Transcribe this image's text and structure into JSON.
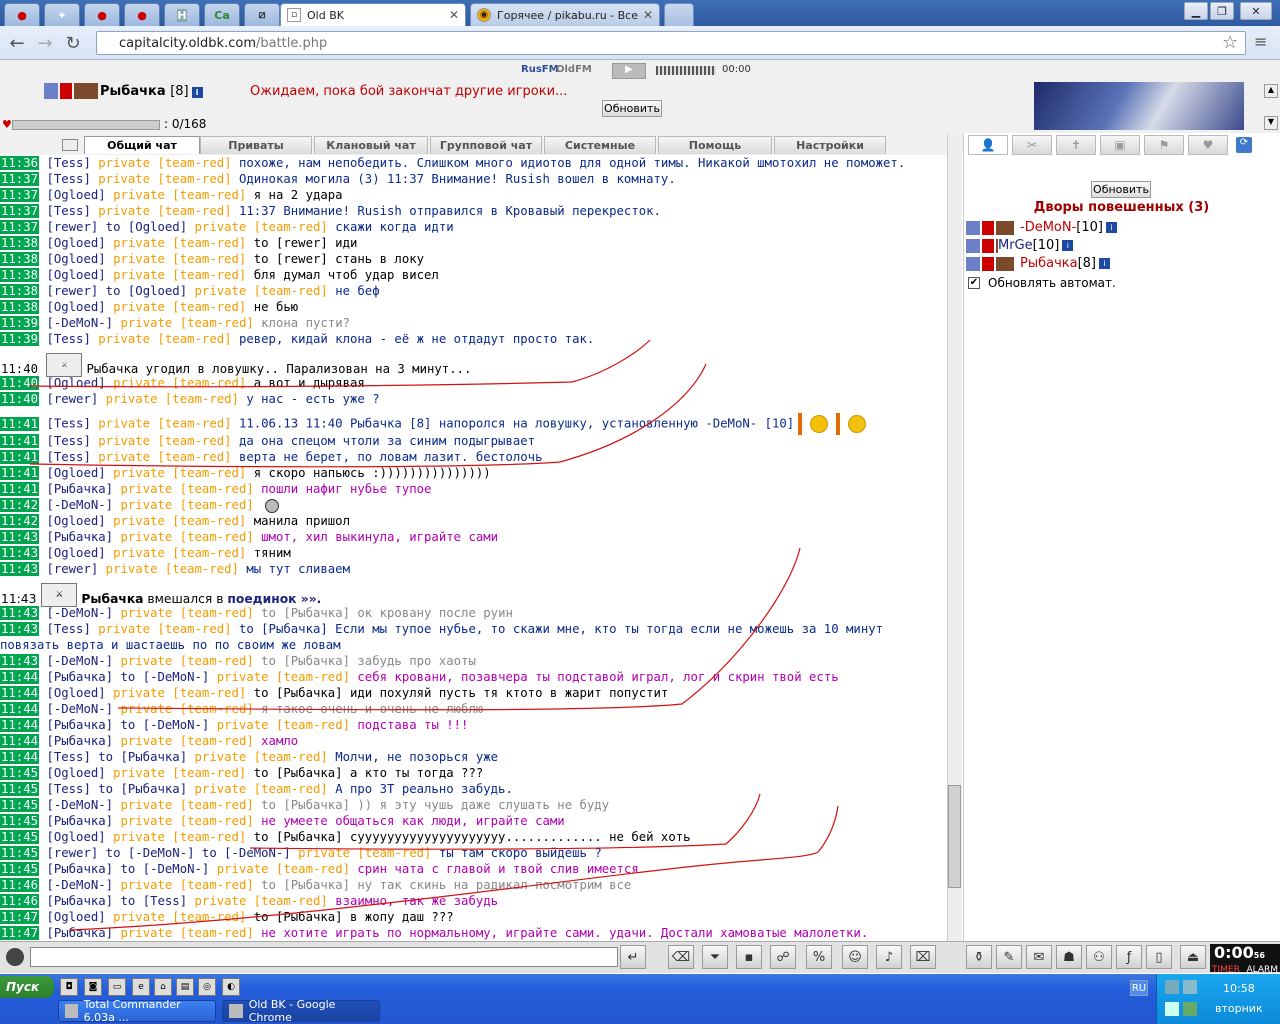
{
  "browser": {
    "pinned_tabs": [
      "",
      "",
      "",
      "",
      "H",
      "Ca",
      ""
    ],
    "tabs": [
      {
        "title": "Old BK",
        "active": true
      },
      {
        "title": "Горячее / pikabu.ru - Все",
        "active": false
      }
    ],
    "url_domain": "capitalcity.oldbk.com",
    "url_path": "/battle.php"
  },
  "header": {
    "radio_left": "RusFM",
    "radio_right": "OldFM",
    "radio_time": "00:00",
    "player_name": "Рыбачка",
    "player_level": "[8]",
    "wait_message": "Ожидаем, пока бой закончат другие игроки...",
    "refresh_label": "Обновить",
    "hp": ": 0/168"
  },
  "chat_tabs": [
    "Общий чат",
    "Приваты",
    "Клановый чат",
    "Групповой чат",
    "Системные",
    "Помощь",
    "Настройки"
  ],
  "chat_lines": [
    {
      "t": "11:36",
      "n": "[Tess]",
      "p": "private [team-red]",
      "m": "похоже, нам непобедить. Слишком много идиотов для одной тимы. Никакой шмотохил не поможет.",
      "c": "navy"
    },
    {
      "t": "11:37",
      "n": "[Tess]",
      "p": "private [team-red]",
      "m": "Одинокая могила (3) 11:37 Внимание! Rusish вошел в комнату.",
      "c": "navy"
    },
    {
      "t": "11:37",
      "n": "[Ogloed]",
      "p": "private [team-red]",
      "m": "я на 2 удара",
      "c": "black"
    },
    {
      "t": "11:37",
      "n": "[Tess]",
      "p": "private [team-red]",
      "m": "11:37 Внимание! Rusish отправился в Кровавый перекресток.",
      "c": "navy"
    },
    {
      "t": "11:37",
      "n": "[rewer]",
      "to": "to [Ogloed]",
      "p": "private [team-red]",
      "m": "скажи когда идти",
      "c": "navy"
    },
    {
      "t": "11:38",
      "n": "[Ogloed]",
      "p": "private [team-red]",
      "m": "to [rewer] иди",
      "c": "black"
    },
    {
      "t": "11:38",
      "n": "[Ogloed]",
      "p": "private [team-red]",
      "m": "to [rewer] стань в локу",
      "c": "black"
    },
    {
      "t": "11:38",
      "n": "[Ogloed]",
      "p": "private [team-red]",
      "m": "бля думал чтоб удар висел",
      "c": "black"
    },
    {
      "t": "11:38",
      "n": "[rewer]",
      "to": "to [Ogloed]",
      "p": "private [team-red]",
      "m": "не беф",
      "c": "navy"
    },
    {
      "t": "11:38",
      "n": "[Ogloed]",
      "p": "private [team-red]",
      "m": "не бью",
      "c": "black"
    },
    {
      "t": "11:39",
      "n": "[-DeMoN-]",
      "p": "private [team-red]",
      "m": "клона пусти?",
      "c": "gray"
    },
    {
      "t": "11:39",
      "n": "[Tess]",
      "p": "private [team-red]",
      "m": "ревер, кидай клона - её ж не отдадут просто так.",
      "c": "navy"
    },
    {
      "sys": true,
      "t": "11:40",
      "m": "Рыбачка угодил в ловушку.. Парализован на 3 минут..."
    },
    {
      "t": "11:40",
      "n": "[Ogloed]",
      "p": "private [team-red]",
      "m": "а вот и дырявая",
      "c": "black"
    },
    {
      "t": "11:40",
      "n": "[rewer]",
      "p": "private [team-red]",
      "m": "у нас - есть уже ?",
      "c": "navy"
    },
    {
      "trap": true,
      "t": "11:41",
      "n": "[Tess]",
      "p": "private [team-red]",
      "m": "11.06.13 11:40 Рыбачка [8] напоролся на ловушку, установленную -DeMoN- [10]",
      "c": "navy"
    },
    {
      "t": "11:41",
      "n": "[Tess]",
      "p": "private [team-red]",
      "m": "да она спецом чтоли за синим подыгрывает",
      "c": "navy"
    },
    {
      "t": "11:41",
      "n": "[Tess]",
      "p": "private [team-red]",
      "m": "верта не берет, по ловам лазит. бестолочь",
      "c": "navy"
    },
    {
      "t": "11:41",
      "n": "[Ogloed]",
      "p": "private [team-red]",
      "m": "я скоро напьюсь :)))))))))))))))",
      "c": "black"
    },
    {
      "t": "11:41",
      "n": "[Рыбачка]",
      "p": "private [team-red]",
      "m": "пошли нафиг нубье тупое",
      "c": "mag"
    },
    {
      "smile": true,
      "t": "11:42",
      "n": "[-DeMoN-]",
      "p": "private [team-red]",
      "m": "",
      "c": "gray"
    },
    {
      "t": "11:42",
      "n": "[Ogloed]",
      "p": "private [team-red]",
      "m": "манила пришол",
      "c": "black"
    },
    {
      "t": "11:43",
      "n": "[Рыбачка]",
      "p": "private [team-red]",
      "m": "шмот, хил выкинула, играйте сами",
      "c": "mag"
    },
    {
      "t": "11:43",
      "n": "[Ogloed]",
      "p": "private [team-red]",
      "m": "тяним",
      "c": "black"
    },
    {
      "t": "11:43",
      "n": "[rewer]",
      "p": "private [team-red]",
      "m": "мы тут сливаем",
      "c": "navy"
    },
    {
      "sys2": true,
      "t": "11:43",
      "m1": "Рыбачка",
      "m2": "вмешался в",
      "m3": "поединок »»."
    },
    {
      "t": "11:43",
      "n": "[-DeMoN-]",
      "p": "private [team-red]",
      "m": "to [Рыбачка] ок кровану после руин",
      "c": "gray"
    },
    {
      "wrap": true,
      "t": "11:43",
      "n": "[Tess]",
      "p": "private [team-red]",
      "m": "to [Рыбачка] Если мы тупое нубье, то скажи мне, кто ты тогда если не можешь за 10 минут повязать верта и шастаешь по по своим же ловам",
      "c": "navy"
    },
    {
      "t": "11:43",
      "n": "[-DeMoN-]",
      "p": "private [team-red]",
      "m": "to [Рыбачка] забудь про хаоты",
      "c": "gray"
    },
    {
      "t": "11:44",
      "n": "[Рыбачка]",
      "to": "to [-DeMoN-]",
      "p": "private [team-red]",
      "m": "себя кровани, позавчера ты подставой играл, лог и скрин твой есть",
      "c": "mag"
    },
    {
      "t": "11:44",
      "n": "[Ogloed]",
      "p": "private [team-red]",
      "m": "to [Рыбачка] иди похуляй пусть тя ктото в жарит попустит",
      "c": "black"
    },
    {
      "t": "11:44",
      "n": "[-DeMoN-]",
      "p": "private [team-red]",
      "m": "я такое очень и очень не люблю",
      "c": "gray"
    },
    {
      "t": "11:44",
      "n": "[Рыбачка]",
      "to": "to [-DeMoN-]",
      "p": "private [team-red]",
      "m": "подстава ты !!!",
      "c": "mag"
    },
    {
      "t": "11:44",
      "n": "[Рыбачка]",
      "p": "private [team-red]",
      "m": "хамло",
      "c": "mag"
    },
    {
      "t": "11:44",
      "n": "[Tess]",
      "to": "to [Рыбачка]",
      "p": "private [team-red]",
      "m": "Молчи, не позорься уже",
      "c": "navy"
    },
    {
      "t": "11:45",
      "n": "[Ogloed]",
      "p": "private [team-red]",
      "m": "to [Рыбачка] а кто ты тогда ???",
      "c": "black"
    },
    {
      "t": "11:45",
      "n": "[Tess]",
      "to": "to [Рыбачка]",
      "p": "private [team-red]",
      "m": "А про ЗТ реально забудь.",
      "c": "navy"
    },
    {
      "t": "11:45",
      "n": "[-DeMoN-]",
      "p": "private [team-red]",
      "m": "to [Рыбачка] )) я эту чушь даже слушать не буду",
      "c": "gray"
    },
    {
      "t": "11:45",
      "n": "[Рыбачка]",
      "p": "private [team-red]",
      "m": "не умеете общаться как люди, играйте сами",
      "c": "mag"
    },
    {
      "t": "11:45",
      "n": "[Ogloed]",
      "p": "private [team-red]",
      "m": "to [Рыбачка] суууууууууууууууууууу............. не бей хоть",
      "c": "black"
    },
    {
      "t": "11:45",
      "n": "[rewer]",
      "to": "to [-DeMoN-] to [-DeMoN-]",
      "p": "private [team-red]",
      "m": "ты там скоро выйдешь ?",
      "c": "navy"
    },
    {
      "t": "11:45",
      "n": "[Рыбачка]",
      "to": "to [-DeMoN-]",
      "p": "private [team-red]",
      "m": "срин чата с главой и твой слив имеется",
      "c": "mag"
    },
    {
      "t": "11:46",
      "n": "[-DeMoN-]",
      "p": "private [team-red]",
      "m": "to [Рыбачка] ну так скинь на радикал посмотрим все",
      "c": "gray"
    },
    {
      "t": "11:46",
      "n": "[Рыбачка]",
      "to": "to [Tess]",
      "p": "private [team-red]",
      "m": "взаимно, так же забудь",
      "c": "mag"
    },
    {
      "t": "11:47",
      "n": "[Ogloed]",
      "p": "private [team-red]",
      "m": "to [Рыбачка] в жопу даш ???",
      "c": "black"
    },
    {
      "t": "11:47",
      "n": "[Рыбачка]",
      "p": "private [team-red]",
      "m": "не хотите играть по нормальному, играйте сами. удачи. Достали хамоватые малолетки.",
      "c": "mag"
    }
  ],
  "right_panel": {
    "refresh_label": "Обновить",
    "title": "Дворы повешенных (3)",
    "members": [
      {
        "name": "-DeMoN-",
        "level": "[10]",
        "color": "#c00000"
      },
      {
        "name": "MrGe",
        "level": "[10]",
        "color": "#1a237e"
      },
      {
        "name": "Рыбачка",
        "level": "[8]",
        "color": "#c00000"
      }
    ],
    "auto_refresh": "Обновлять автомат.",
    "auto_refresh_checked": "✔"
  },
  "timer": {
    "time": "0:00",
    "sub": "56",
    "timer": "TIMER",
    "alarm": "ALARM"
  },
  "taskbar": {
    "start": "Пуск",
    "tasks": [
      "Total Commander 6.03a ...",
      "Old BK - Google Chrome"
    ],
    "lang": "RU",
    "clock": "10:58",
    "day": "вторник"
  },
  "colors": {
    "time_bg": "#00a64f",
    "private": "#f29c00",
    "system_red": "#c00000"
  }
}
